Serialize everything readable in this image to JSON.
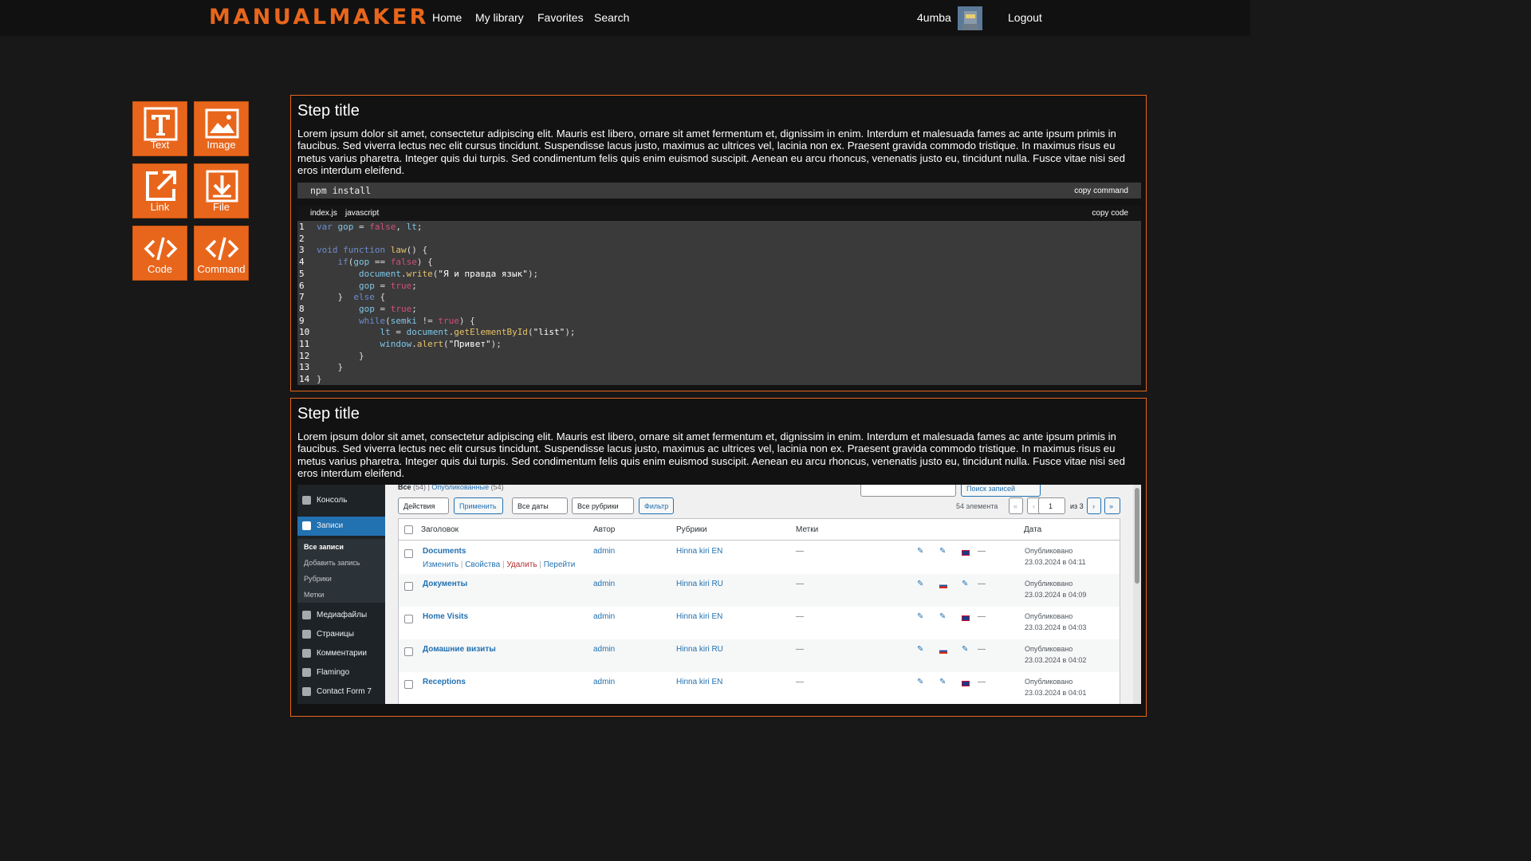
{
  "nav": {
    "logo": "MANUALMAKER",
    "links": [
      "Home",
      "My library",
      "Favorites",
      "Search"
    ],
    "user": "4umba",
    "logout": "Logout"
  },
  "tools": [
    "Text",
    "Image",
    "Link",
    "File",
    "Code",
    "Command"
  ],
  "steps": [
    {
      "title": "Step title",
      "text": "Lorem ipsum dolor sit amet, consectetur adipiscing elit. Mauris est libero, ornare sit amet fermentum et, dignissim in enim. Interdum et malesuada fames ac ante ipsum primis in faucibus. Sed viverra lectus nec elit cursus tincidunt. Suspendisse lacus justo, maximus ac ultrices vel, lacinia non ex. Praesent gravida commodo tristique. In maximus risus eu metus varius pharetra. Integer quis dui turpis. Sed condimentum felis quis enim euismod suscipit. Aenean eu arcu rhoncus, venenatis justo eu, tincidunt nulla. Fusce vitae nisi sed eros interdum eleifend.",
      "command": "npm install",
      "copy_command": "copy command",
      "code_file": "index.js",
      "code_lang": "javascript",
      "copy_code": "copy code"
    },
    {
      "title": "Step title",
      "text": "Lorem ipsum dolor sit amet, consectetur adipiscing elit. Mauris est libero, ornare sit amet fermentum et, dignissim in enim. Interdum et malesuada fames ac ante ipsum primis in faucibus. Sed viverra lectus nec elit cursus tincidunt. Suspendisse lacus justo, maximus ac ultrices vel, lacinia non ex. Praesent gravida commodo tristique. In maximus risus eu metus varius pharetra. Integer quis dui turpis. Sed condimentum felis quis enim euismod suscipit. Aenean eu arcu rhoncus, venenatis justo eu, tincidunt nulla. Fusce vitae nisi sed eros interdum eleifend."
    }
  ],
  "code_lines": [
    "var gop = false, lt;",
    "",
    "void function law() {",
    "    if(gop == false) {",
    "        document.write(\"Я и правда язык\");",
    "        gop = true;",
    "    }  else {",
    "        gop = true;",
    "        while(semki != true) {",
    "            lt = document.getElementById(\"list\");",
    "            window.alert(\"Привет\");",
    "        }",
    "    }",
    "}"
  ],
  "wp": {
    "sidebar": [
      "Консоль",
      "Записи",
      "Медиафайлы",
      "Страницы",
      "Комментарии",
      "Flamingo",
      "Contact Form 7"
    ],
    "submenu": [
      "Все записи",
      "Добавить запись",
      "Рубрики",
      "Метки"
    ],
    "filters": {
      "all": "Все",
      "all_count": "(54)",
      "published": "Опубликованные",
      "published_count": "(54)",
      "actions": "Действия",
      "apply": "Применить",
      "dates": "Все даты",
      "rubrics": "Все рубрики",
      "filter": "Фильтр",
      "count": "54 элемента",
      "page": "1",
      "of": "из 3",
      "search": "Поиск записей"
    },
    "headers": [
      "Заголовок",
      "Автор",
      "Рубрики",
      "Метки",
      "Дата"
    ],
    "row_actions": [
      "Изменить",
      "Свойства",
      "Удалить",
      "Перейти"
    ],
    "rows": [
      {
        "title": "Documents",
        "author": "admin",
        "cat": "Hinna kiri EN",
        "tags": "—",
        "status": "Опубликовано",
        "date": "23.03.2024 в 04:11"
      },
      {
        "title": "Документы",
        "author": "admin",
        "cat": "Hinna kiri RU",
        "tags": "—",
        "status": "Опубликовано",
        "date": "23.03.2024 в 04:09"
      },
      {
        "title": "Home Visits",
        "author": "admin",
        "cat": "Hinna kiri EN",
        "tags": "—",
        "status": "Опубликовано",
        "date": "23.03.2024 в 04:03"
      },
      {
        "title": "Домашние визиты",
        "author": "admin",
        "cat": "Hinna kiri RU",
        "tags": "—",
        "status": "Опубликовано",
        "date": "23.03.2024 в 04:02"
      },
      {
        "title": "Receptions",
        "author": "admin",
        "cat": "Hinna kiri EN",
        "tags": "—",
        "status": "Опубликовано",
        "date": "23.03.2024 в 04:01"
      }
    ]
  }
}
